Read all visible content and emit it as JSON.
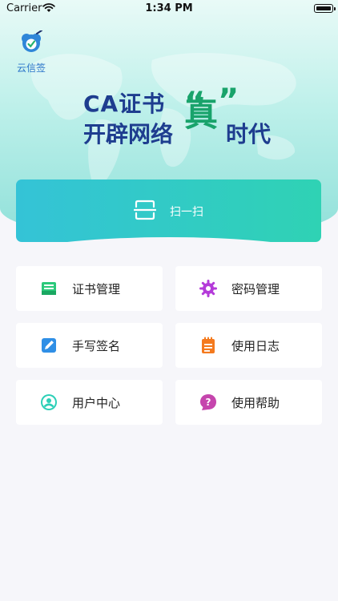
{
  "status_bar": {
    "carrier": "Carrier",
    "time": "1:34 PM"
  },
  "app": {
    "name": "云信签"
  },
  "banner": {
    "line1": "CA证书",
    "line2_prefix": "开辟网络",
    "emphasis": "真",
    "line2_suffix": "时代",
    "colors": {
      "primary": "#1e3d8f",
      "accent": "#19a36b"
    }
  },
  "scan": {
    "label": "扫一扫",
    "icon": "scan-icon"
  },
  "menu": [
    {
      "label": "证书管理",
      "icon": "certificate-icon",
      "color": "#2bc97a"
    },
    {
      "label": "密码管理",
      "icon": "password-gear-icon",
      "color": "#b43bd9"
    },
    {
      "label": "手写签名",
      "icon": "handwrite-sign-icon",
      "color": "#2f8fe6"
    },
    {
      "label": "使用日志",
      "icon": "log-notebook-icon",
      "color": "#f47a1e"
    },
    {
      "label": "用户中心",
      "icon": "user-center-icon",
      "color": "#2ccfb7"
    },
    {
      "label": "使用帮助",
      "icon": "help-icon",
      "color": "#c545ad"
    }
  ]
}
